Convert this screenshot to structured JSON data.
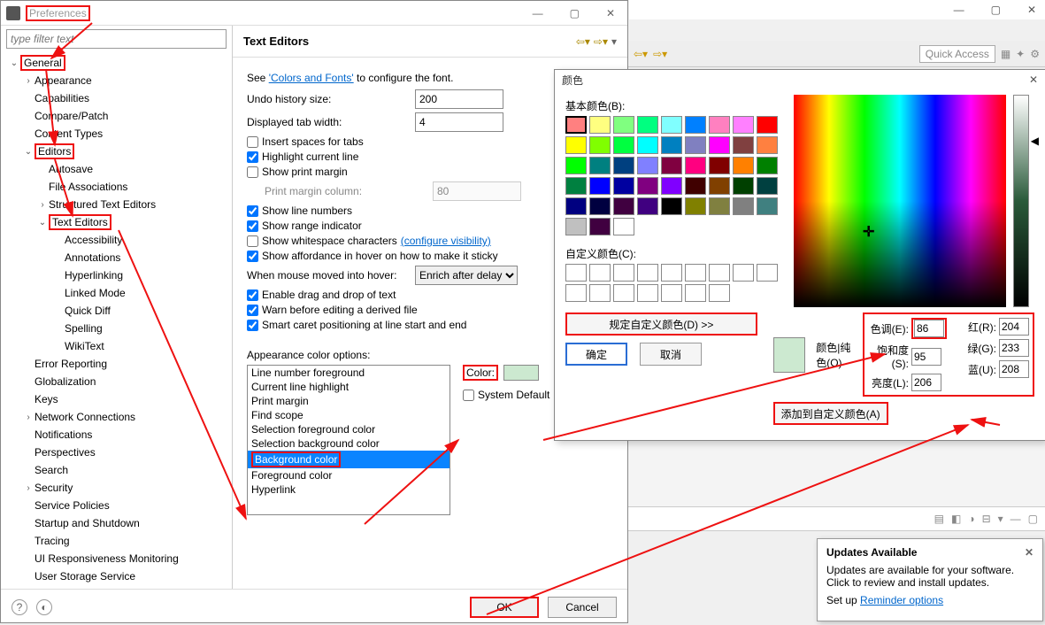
{
  "prefs": {
    "title": "Preferences",
    "filter_placeholder": "type filter text",
    "tree": {
      "general": "General",
      "appearance": "Appearance",
      "capabilities": "Capabilities",
      "compare_patch": "Compare/Patch",
      "content_types": "Content Types",
      "editors": "Editors",
      "autosave": "Autosave",
      "file_assoc": "File Associations",
      "struct_editors": "Structured Text Editors",
      "text_editors": "Text Editors",
      "accessibility": "Accessibility",
      "annotations": "Annotations",
      "hyperlinking": "Hyperlinking",
      "linked_mode": "Linked Mode",
      "quick_diff": "Quick Diff",
      "spelling": "Spelling",
      "wikitext": "WikiText",
      "error_reporting": "Error Reporting",
      "globalization": "Globalization",
      "keys": "Keys",
      "network": "Network Connections",
      "notifications": "Notifications",
      "perspectives": "Perspectives",
      "search": "Search",
      "security": "Security",
      "service_policies": "Service Policies",
      "startup": "Startup and Shutdown",
      "tracing": "Tracing",
      "ui_resp": "UI Responsiveness Monitoring",
      "user_storage": "User Storage Service"
    },
    "page_title": "Text Editors",
    "see_prefix": "See ",
    "colors_fonts_link": "'Colors and Fonts'",
    "see_suffix": " to configure the font.",
    "undo_label": "Undo history size:",
    "undo_value": "200",
    "tab_label": "Displayed tab width:",
    "tab_value": "4",
    "insert_spaces": "Insert spaces for tabs",
    "highlight_line": "Highlight current line",
    "show_print_margin": "Show print margin",
    "print_margin_col_label": "Print margin column:",
    "print_margin_col_value": "80",
    "show_line_numbers": "Show line numbers",
    "show_range": "Show range indicator",
    "show_whitespace": "Show whitespace characters ",
    "configure_visibility": "(configure visibility)",
    "show_affordance": "Show affordance in hover on how to make it sticky",
    "hover_label": "When mouse moved into hover:",
    "hover_value": "Enrich after delay",
    "enable_dnd": "Enable drag and drop of text",
    "warn_derived": "Warn before editing a derived file",
    "smart_caret": "Smart caret positioning at line start and end",
    "appearance_colors_label": "Appearance color options:",
    "color_items": [
      "Line number foreground",
      "Current line highlight",
      "Print margin",
      "Find scope",
      "Selection foreground color",
      "Selection background color",
      "Background color",
      "Foreground color",
      "Hyperlink"
    ],
    "color_label": "Color:",
    "system_default": "System Default",
    "ok": "OK",
    "cancel": "Cancel"
  },
  "ide": {
    "quick_access": "Quick Access"
  },
  "color_dialog": {
    "title": "颜色",
    "basic_label": "基本颜色(B):",
    "custom_label": "自定义颜色(C):",
    "define_custom": "规定自定义颜色(D) >>",
    "ok": "确定",
    "cancel": "取消",
    "color_solid": "颜色|纯色(O)",
    "hue_label": "色调(E):",
    "sat_label": "饱和度(S):",
    "lum_label": "亮度(L):",
    "red_label": "红(R):",
    "green_label": "绿(G):",
    "blue_label": "蓝(U):",
    "hue": "86",
    "sat": "95",
    "lum": "206",
    "red": "204",
    "green": "233",
    "blue": "208",
    "add_custom": "添加到自定义颜色(A)",
    "basic_colors": [
      "#ff8080",
      "#ffff80",
      "#80ff80",
      "#00ff80",
      "#80ffff",
      "#0080ff",
      "#ff80c0",
      "#ff80ff",
      "#ff0000",
      "#ffff00",
      "#80ff00",
      "#00ff40",
      "#00ffff",
      "#0080c0",
      "#8080c0",
      "#ff00ff",
      "#804040",
      "#ff8040",
      "#00ff00",
      "#008080",
      "#004080",
      "#8080ff",
      "#800040",
      "#ff0080",
      "#800000",
      "#ff8000",
      "#008000",
      "#008040",
      "#0000ff",
      "#0000a0",
      "#800080",
      "#8000ff",
      "#400000",
      "#804000",
      "#004000",
      "#004040",
      "#000080",
      "#000040",
      "#400040",
      "#400080",
      "#000000",
      "#808000",
      "#808040",
      "#808080",
      "#408080",
      "#c0c0c0",
      "#400040",
      "#ffffff"
    ]
  },
  "updates": {
    "title": "Updates Available",
    "body1": "Updates are available for your software.",
    "body2": "Click to review and install updates.",
    "setup_prefix": "Set up ",
    "reminder_link": "Reminder options"
  }
}
